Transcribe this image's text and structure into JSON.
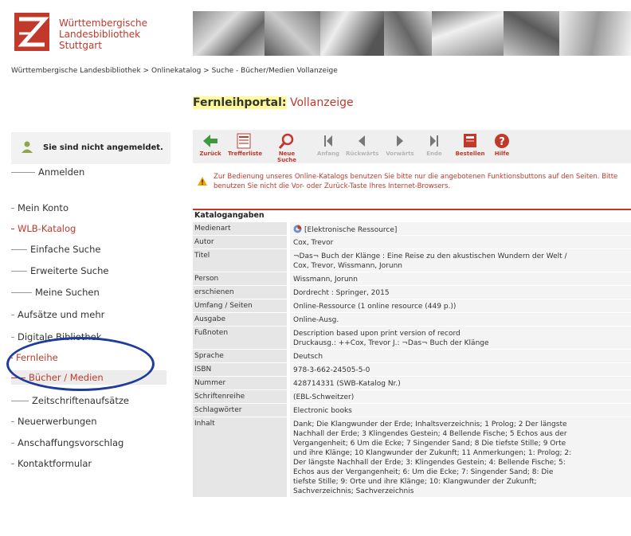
{
  "logo": {
    "lines": [
      "Württembergische",
      "Landesbibliothek",
      "Stuttgart"
    ],
    "color": "#c0392b"
  },
  "breadcrumb": "Württembergische Landesbibliothek > Onlinekatalog > Suche - Bücher/Medien Vollanzeige",
  "portal": {
    "highlight": "Fernleihportal:",
    "title": "Vollanzeige"
  },
  "login": {
    "text": "Sie sind nicht angemeldet."
  },
  "nav": [
    {
      "label": "Anmelden",
      "red": false
    },
    {
      "label": "Mein Konto",
      "red": false
    },
    {
      "label": "WLB-Katalog",
      "red": true
    },
    {
      "label": "Einfache Suche",
      "red": false
    },
    {
      "label": "Erweiterte Suche",
      "red": false
    },
    {
      "label": "Meine Suchen",
      "red": false
    },
    {
      "label": "Aufsätze und mehr",
      "red": false
    },
    {
      "label": "Digitale Bibliothek",
      "red": false
    },
    {
      "label": "Fernleihe",
      "red": true
    },
    {
      "label": "Bücher / Medien",
      "red": true
    },
    {
      "label": "Zeitschriftenaufsätze",
      "red": false
    },
    {
      "label": "Neuerwerbungen",
      "red": false
    },
    {
      "label": "Anschaffungsvorschlag",
      "red": false
    },
    {
      "label": "Kontaktformular",
      "red": false
    }
  ],
  "toolbar": {
    "back": "Zurück",
    "hitlist": "Trefferliste",
    "newsearch": "Neue Suche",
    "first": "Anfang",
    "prev": "Rückwärts",
    "next": "Vorwärts",
    "last": "Ende",
    "order": "Bestellen",
    "help": "Hilfe"
  },
  "warning": "Zur Bedienung unseres Online-Katalogs benutzen Sie bitte nur die angebotenen Funktionsbuttons auf den Seiten. Bitte benutzen Sie nicht die Vor- oder Zurück-Taste Ihres Internet-Browsers.",
  "table": {
    "heading": "Katalogangaben",
    "rows": [
      {
        "key": "Medienart",
        "lines": [
          "[Elektronische Ressource]"
        ],
        "icon": true
      },
      {
        "key": "Autor",
        "lines": [
          "Cox, Trevor"
        ]
      },
      {
        "key": "Titel",
        "lines": [
          "¬Das¬ Buch der Klänge : Eine Reise zu den akustischen Wundern der Welt /",
          "Cox, Trevor, Wissmann, Jorunn"
        ]
      },
      {
        "key": "Person",
        "lines": [
          "Wissmann, Jorunn"
        ]
      },
      {
        "key": "erschienen",
        "lines": [
          "Dordrecht : Springer, 2015"
        ]
      },
      {
        "key": "Umfang / Seiten",
        "lines": [
          "Online-Ressource (1 online resource (449 p.))"
        ]
      },
      {
        "key": "Ausgabe",
        "lines": [
          "Online-Ausg."
        ]
      },
      {
        "key": "Fußnoten",
        "lines": [
          "Description based upon print version of record",
          "Druckausg.: ++Cox, Trevor J.: ¬Das¬ Buch der Klänge"
        ]
      },
      {
        "key": "Sprache",
        "lines": [
          "Deutsch"
        ]
      },
      {
        "key": "ISBN",
        "lines": [
          "978-3-662-24505-5-0"
        ]
      },
      {
        "key": "Nummer",
        "lines": [
          "428714331  (SWB-Katalog Nr.)"
        ]
      },
      {
        "key": "Schriftenreihe",
        "lines": [
          "(EBL-Schweitzer)"
        ]
      },
      {
        "key": "Schlagwörter",
        "lines": [
          "Electronic books"
        ]
      },
      {
        "key": "Inhalt",
        "lines": [
          "Dank; Die Klangwunder der Erde; Inhaltsverzeichnis; 1 Prolog; 2 Der längste",
          "Nachhall der Erde; 3 Klingendes Gestein; 4 Bellende Fische; 5 Echos aus der",
          "Vergangenheit; 6 Um die Ecke; 7 Singender Sand; 8 Die tiefste Stille; 9 Orte",
          "und ihre Klänge; 10 Klangwunder der Zukunft; 11 Anmerkungen; 1: Prolog; 2:",
          "Der längste Nachhall der Erde; 3: Klingendes Gestein; 4: Bellende Fische; 5:",
          "Echos aus der Vergangenheit; 6: Um die Ecke; 7: Singender Sand; 8: Die",
          "tiefste Stille; 9: Orte und ihre Klänge; 10: Klangwunder der Zukunft;",
          "Sachverzeichnis; Sachverzeichnis"
        ]
      }
    ]
  }
}
